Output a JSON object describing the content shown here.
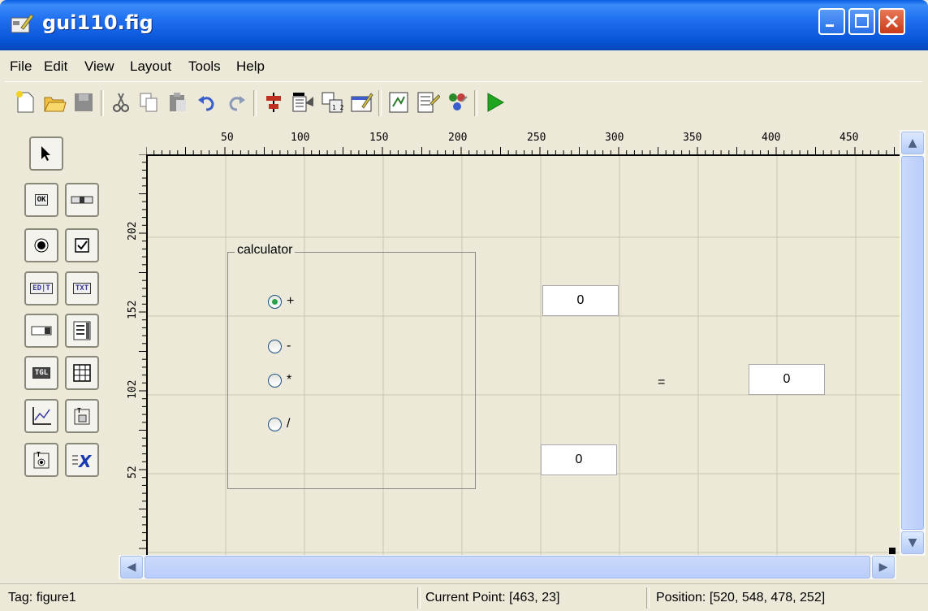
{
  "window": {
    "title": "gui110.fig"
  },
  "menu": [
    "File",
    "Edit",
    "View",
    "Layout",
    "Tools",
    "Help"
  ],
  "toolbar": {
    "buttons": [
      "new-icon",
      "open-icon",
      "save-icon",
      "cut-icon",
      "copy-icon",
      "paste-icon",
      "undo-icon",
      "redo-icon",
      "align-objects-icon",
      "menu-editor-icon",
      "tab-order-editor-icon",
      "toolbar-editor-icon",
      "mfile-editor-icon",
      "property-inspector-icon",
      "object-browser-icon",
      "run-figure-icon"
    ]
  },
  "ruler": {
    "h_labels": [
      "50",
      "100",
      "150",
      "200",
      "250",
      "300",
      "350",
      "400",
      "450"
    ],
    "v_labels": [
      "202",
      "152",
      "102",
      "52"
    ]
  },
  "palette": {
    "items": [
      "select",
      "push-button",
      "slider",
      "radio-button",
      "check-box",
      "edit-text",
      "static-text",
      "popup-menu",
      "listbox",
      "toggle-button",
      "table",
      "axes",
      "panel",
      "button-group",
      "activex-control"
    ],
    "labels": {
      "push": "OK",
      "edit": "ED|T",
      "static": "TXT",
      "toggle": "TGL"
    }
  },
  "panel": {
    "title": "calculator"
  },
  "radios": [
    {
      "label": "+",
      "selected": true
    },
    {
      "label": "-",
      "selected": false
    },
    {
      "label": "*",
      "selected": false
    },
    {
      "label": "/",
      "selected": false
    }
  ],
  "edits": {
    "top": "0",
    "bottom": "0",
    "result": "0"
  },
  "equals": "=",
  "status": {
    "tag": "Tag: figure1",
    "current_point": "Current Point:  [463, 23]",
    "position": "Position: [520, 548, 478, 252]"
  },
  "colors": {
    "titlebar": "#0a5fe0",
    "run_green": "#1fa51f",
    "selected_radio": "#2aa24a"
  }
}
